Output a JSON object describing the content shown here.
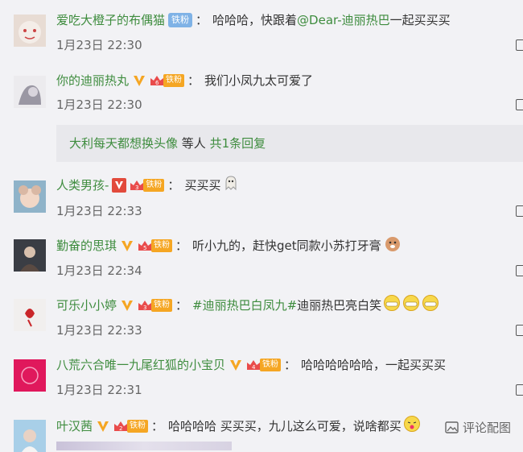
{
  "comments": [
    {
      "user": "爱吃大橙子的布偶猫",
      "fan_label": "铁粉",
      "text_pre": "哈哈哈，快跟着",
      "mention": "@Dear-迪丽热巴",
      "text_post": " 一起买买买",
      "time": "1月23日 22:30"
    },
    {
      "user": "你的迪丽热丸",
      "fan_label": "铁粉",
      "text": "我们小凤九太可爱了",
      "time": "1月23日 22:30"
    },
    {
      "user": "人类男孩-",
      "fan_label": "铁粉",
      "text": "买买买",
      "time": "1月23日 22:33"
    },
    {
      "user": "勤奋的思琪",
      "fan_label": "铁粉",
      "text": "听小九的，赶快get同款小苏打牙膏",
      "time": "1月23日 22:34"
    },
    {
      "user": "可乐小小婷",
      "fan_label": "铁粉",
      "topic": "#迪丽热巴白凤九#",
      "text": " 迪丽热巴亮白笑",
      "time": "1月23日 22:33"
    },
    {
      "user": "八荒六合唯一九尾红狐的小宝贝",
      "fan_label": "铁粉",
      "text": "哈哈哈哈哈哈，一起买买买",
      "time": "1月23日 22:31"
    },
    {
      "user": "叶汉茜",
      "fan_label": "铁粉",
      "text": "哈哈哈哈 买买买，九儿这么可爱，说啥都买",
      "time": ""
    }
  ],
  "reply_box": {
    "name": "大利每天都想换头像",
    "middle": " 等人 ",
    "count": "共1条回复"
  },
  "comment_image_link": "评论配图",
  "colors": {
    "username": "#3e8c3e",
    "fan_badge": "#f5a623",
    "vip_v": "#f5a623"
  }
}
